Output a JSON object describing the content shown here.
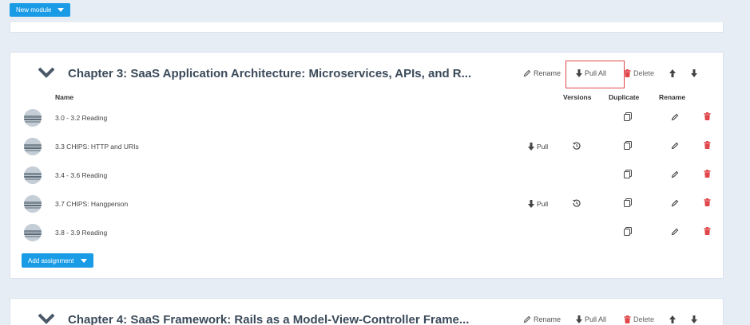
{
  "toolbar": {
    "new_module_label": "New module"
  },
  "module3": {
    "title": "Chapter 3: SaaS Application Architecture: Microservices, APIs, and R...",
    "actions": {
      "rename": "Rename",
      "pull_all": "Pull All",
      "delete": "Delete"
    },
    "columns": {
      "name": "Name",
      "versions": "Versions",
      "duplicate": "Duplicate",
      "rename": "Rename"
    },
    "assignments": [
      {
        "name": "3.0 - 3.2 Reading",
        "pull": ""
      },
      {
        "name": "3.3 CHIPS: HTTP and URIs",
        "pull": "Pull"
      },
      {
        "name": "3.4 - 3.6 Reading",
        "pull": ""
      },
      {
        "name": "3.7 CHIPS: Hangperson",
        "pull": "Pull"
      },
      {
        "name": "3.8 - 3.9 Reading",
        "pull": ""
      }
    ],
    "add_assignment_label": "Add assignment"
  },
  "module4": {
    "title": "Chapter 4: SaaS Framework: Rails as a Model-View-Controller Frame...",
    "actions": {
      "rename": "Rename",
      "pull_all": "Pull All",
      "delete": "Delete"
    }
  },
  "colors": {
    "accent": "#1a9be6",
    "danger": "#e0464a",
    "title": "#3b4a5a",
    "background": "#e6edf5"
  }
}
